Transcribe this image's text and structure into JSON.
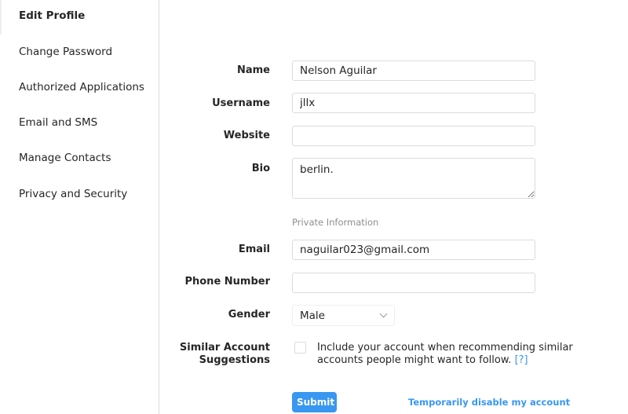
{
  "sidebar": {
    "items": [
      {
        "label": "Edit Profile"
      },
      {
        "label": "Change Password"
      },
      {
        "label": "Authorized Applications"
      },
      {
        "label": "Email and SMS"
      },
      {
        "label": "Manage Contacts"
      },
      {
        "label": "Privacy and Security"
      }
    ]
  },
  "form": {
    "name": {
      "label": "Name",
      "value": "Nelson Aguilar"
    },
    "username": {
      "label": "Username",
      "value": "jllx"
    },
    "website": {
      "label": "Website",
      "value": ""
    },
    "bio": {
      "label": "Bio",
      "value": "berlin."
    },
    "private_heading": "Private Information",
    "email": {
      "label": "Email",
      "value": "naguilar023@gmail.com"
    },
    "phone": {
      "label": "Phone Number",
      "value": ""
    },
    "gender": {
      "label": "Gender",
      "value": "Male"
    },
    "similar": {
      "label_line1": "Similar Account",
      "label_line2": "Suggestions",
      "text": "Include your account when recommending similar accounts people might want to follow.",
      "help": "[?]",
      "checked": false
    },
    "submit_label": "Submit",
    "disable_link": "Temporarily disable my account"
  },
  "colors": {
    "accent": "#3897f0"
  }
}
